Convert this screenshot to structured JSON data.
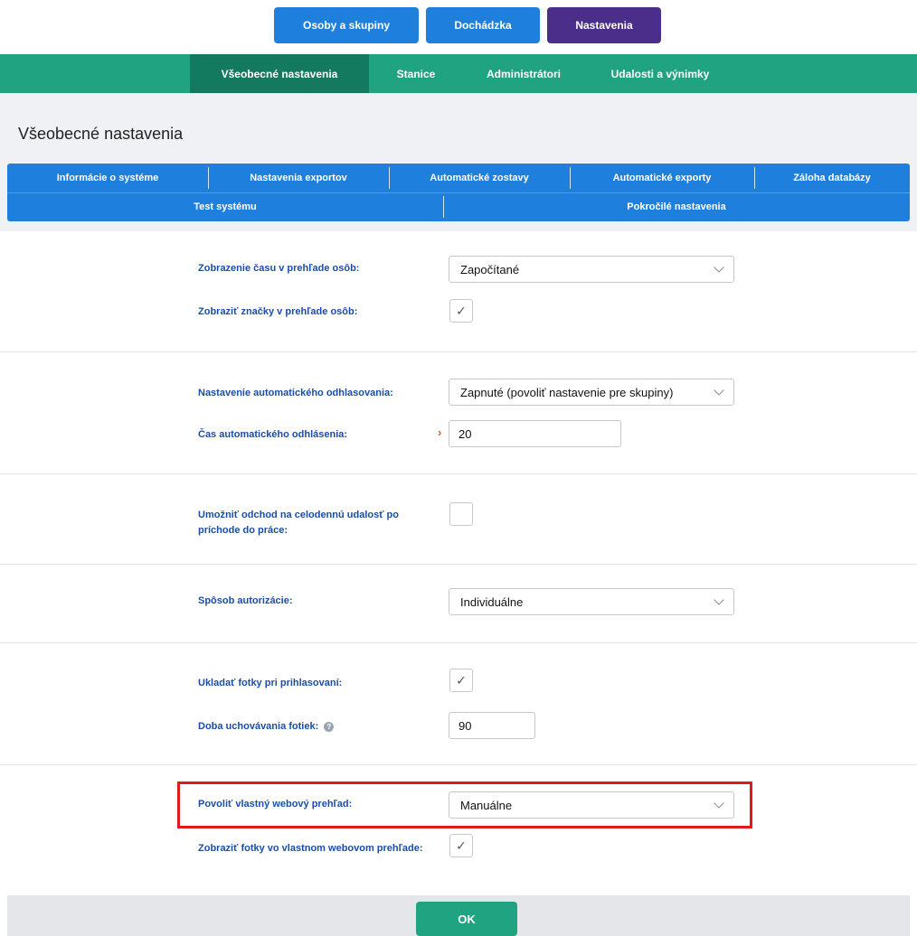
{
  "top_nav": {
    "people": "Osoby a skupiny",
    "attendance": "Dochádzka",
    "settings": "Nastavenia"
  },
  "sub_nav": {
    "general": "Všeobecné nastavenia",
    "stations": "Stanice",
    "admins": "Administrátori",
    "events": "Udalosti a výnimky"
  },
  "page": {
    "title": "Všeobecné nastavenia"
  },
  "tabs": {
    "system_info": "Informácie o systéme",
    "export_settings": "Nastavenia exportov",
    "auto_reports": "Automatické zostavy",
    "auto_exports": "Automatické exporty",
    "db_backup": "Záloha databázy",
    "system_test": "Test systému",
    "advanced": "Pokročilé nastavenia"
  },
  "form": {
    "time_display_label": "Zobrazenie času v prehľade osôb:",
    "time_display_value": "Započítané",
    "show_tags_label": "Zobraziť značky v prehľade osôb:",
    "show_tags_checked": "✓",
    "auto_logout_label": "Nastavenie automatického odhlasovania:",
    "auto_logout_value": "Zapnuté (povoliť nastavenie pre skupiny)",
    "auto_logout_time_label": "Čas automatického odhlásenia:",
    "auto_logout_time_value": "20",
    "required_mark": "›",
    "allow_departure_label": "Umožniť odchod na celodennú udalosť po príchode do práce:",
    "auth_method_label": "Spôsob autorizácie:",
    "auth_method_value": "Individuálne",
    "save_photos_label": "Ukladať fotky pri prihlasovaní:",
    "save_photos_checked": "✓",
    "photo_retention_label": "Doba uchovávania fotiek:",
    "photo_retention_info": "?",
    "photo_retention_value": "90",
    "custom_web_label": "Povoliť vlastný webový prehľad:",
    "custom_web_value": "Manuálne",
    "show_photos_web_label": "Zobraziť fotky vo vlastnom webovom prehľade:",
    "show_photos_web_checked": "✓"
  },
  "footer": {
    "ok_label": "OK"
  },
  "colors": {
    "blue": "#1f7fdd",
    "purple": "#4b2e8a",
    "green": "#1fa380",
    "dark_green": "#137a5f",
    "label_blue": "#1a4ea8",
    "highlight_red": "#e01a1a"
  }
}
